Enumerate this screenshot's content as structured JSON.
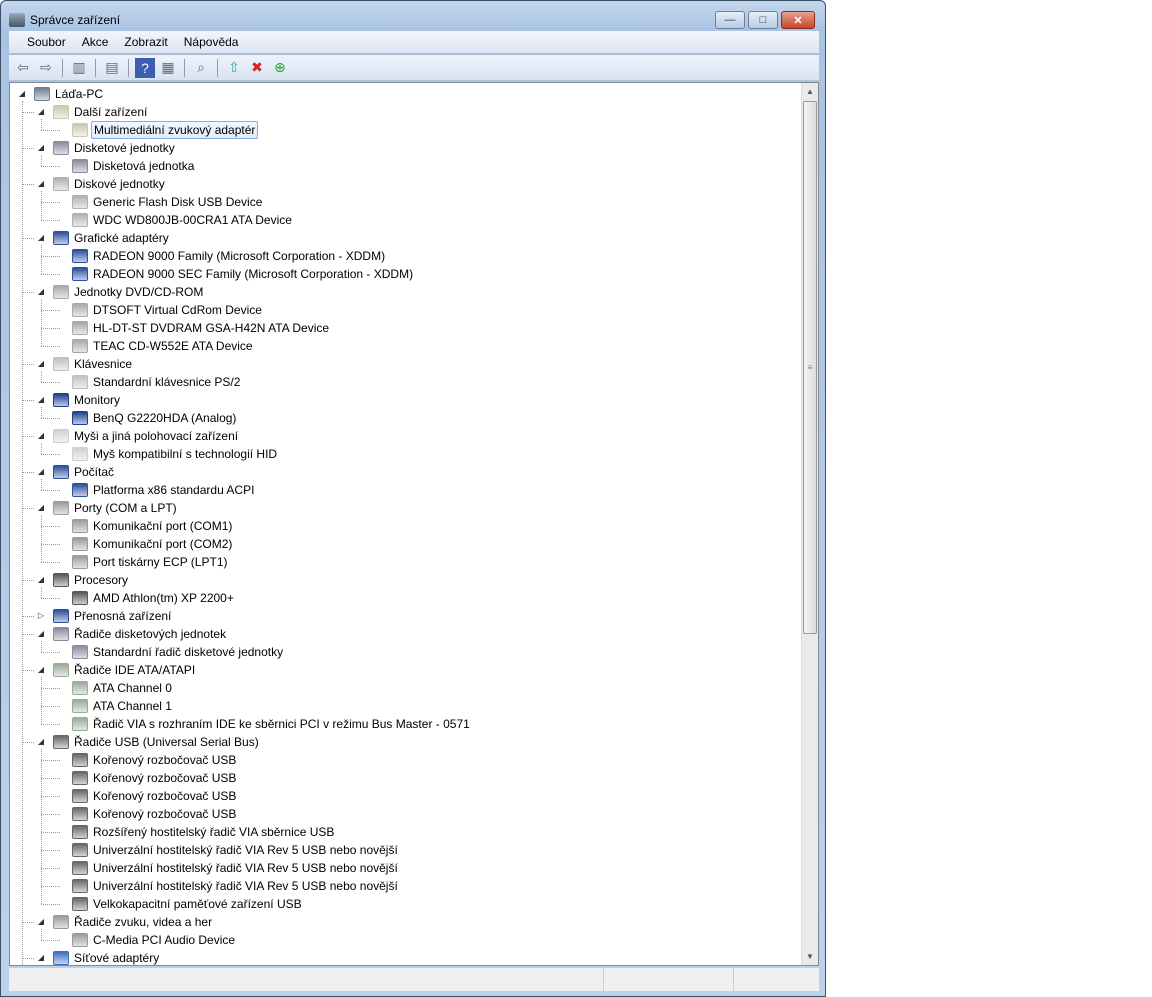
{
  "window": {
    "title": "Správce zařízení",
    "minimize": "—",
    "maximize": "□",
    "close": "✕"
  },
  "menu": [
    "Soubor",
    "Akce",
    "Zobrazit",
    "Nápověda"
  ],
  "toolbar": [
    "back-icon",
    "forward-icon",
    "|",
    "show-hide-console-tree-icon",
    "|",
    "properties-icon",
    "|",
    "help-icon",
    "show-action-pane-icon",
    "|",
    "scan-hardware-icon",
    "|",
    "update-driver-icon",
    "uninstall-icon",
    "enable-device-icon"
  ],
  "tree": [
    {
      "l": 0,
      "t": "Láďa-PC",
      "e": "open",
      "c": "#6b7f99"
    },
    {
      "l": 1,
      "t": "Další zařízení",
      "e": "open",
      "c": "#c9c9b0"
    },
    {
      "l": 2,
      "t": "Multimediální zvukový adaptér",
      "c": "#c9c9b0",
      "sel": true
    },
    {
      "l": 1,
      "t": "Disketové jednotky",
      "e": "open",
      "c": "#8a8aa0"
    },
    {
      "l": 2,
      "t": "Disketová jednotka",
      "c": "#8a8aa0"
    },
    {
      "l": 1,
      "t": "Diskové jednotky",
      "e": "open",
      "c": "#b0b0b0"
    },
    {
      "l": 2,
      "t": "Generic Flash Disk USB Device",
      "c": "#b0b0b0"
    },
    {
      "l": 2,
      "t": "WDC WD800JB-00CRA1 ATA Device",
      "c": "#b0b0b0"
    },
    {
      "l": 1,
      "t": "Grafické adaptéry",
      "e": "open",
      "c": "#2a4f9e"
    },
    {
      "l": 2,
      "t": "RADEON 9000 Family (Microsoft Corporation - XDDM)",
      "c": "#2a4f9e"
    },
    {
      "l": 2,
      "t": "RADEON 9000 SEC Family (Microsoft Corporation - XDDM)",
      "c": "#2a4f9e"
    },
    {
      "l": 1,
      "t": "Jednotky DVD/CD-ROM",
      "e": "open",
      "c": "#a8a8a8"
    },
    {
      "l": 2,
      "t": "DTSOFT Virtual CdRom Device",
      "c": "#a8a8a8"
    },
    {
      "l": 2,
      "t": "HL-DT-ST DVDRAM GSA-H42N ATA Device",
      "c": "#a8a8a8"
    },
    {
      "l": 2,
      "t": "TEAC CD-W552E ATA Device",
      "c": "#a8a8a8"
    },
    {
      "l": 1,
      "t": "Klávesnice",
      "e": "open",
      "c": "#c0c0c0"
    },
    {
      "l": 2,
      "t": "Standardní klávesnice PS/2",
      "c": "#c0c0c0"
    },
    {
      "l": 1,
      "t": "Monitory",
      "e": "open",
      "c": "#1d3f8f"
    },
    {
      "l": 2,
      "t": "BenQ G2220HDA (Analog)",
      "c": "#1d3f8f"
    },
    {
      "l": 1,
      "t": "Myši a jiná polohovací zařízení",
      "e": "open",
      "c": "#d0d0d0"
    },
    {
      "l": 2,
      "t": "Myš kompatibilní s technologií HID",
      "c": "#d0d0d0"
    },
    {
      "l": 1,
      "t": "Počítač",
      "e": "open",
      "c": "#2b4f9a"
    },
    {
      "l": 2,
      "t": "Platforma x86 standardu ACPI",
      "c": "#2b4f9a"
    },
    {
      "l": 1,
      "t": "Porty (COM a LPT)",
      "e": "open",
      "c": "#9a9a9a"
    },
    {
      "l": 2,
      "t": "Komunikační port (COM1)",
      "c": "#9a9a9a"
    },
    {
      "l": 2,
      "t": "Komunikační port (COM2)",
      "c": "#9a9a9a"
    },
    {
      "l": 2,
      "t": "Port tiskárny ECP (LPT1)",
      "c": "#9a9a9a"
    },
    {
      "l": 1,
      "t": "Procesory",
      "e": "open",
      "c": "#555"
    },
    {
      "l": 2,
      "t": "AMD Athlon(tm) XP 2200+",
      "c": "#555"
    },
    {
      "l": 1,
      "t": "Přenosná zařízení",
      "e": "closed",
      "c": "#2b4f9a"
    },
    {
      "l": 1,
      "t": "Řadiče disketových jednotek",
      "e": "open",
      "c": "#8a8aa0"
    },
    {
      "l": 2,
      "t": "Standardní řadič disketové jednotky",
      "c": "#8a8aa0"
    },
    {
      "l": 1,
      "t": "Řadiče IDE ATA/ATAPI",
      "e": "open",
      "c": "#9aaa9a"
    },
    {
      "l": 2,
      "t": "ATA Channel 0",
      "c": "#9aaa9a"
    },
    {
      "l": 2,
      "t": "ATA Channel 1",
      "c": "#9aaa9a"
    },
    {
      "l": 2,
      "t": "Řadič VIA s rozhraním IDE ke sběrnici PCI v režimu Bus Master - 0571",
      "c": "#9aaa9a"
    },
    {
      "l": 1,
      "t": "Řadiče USB (Universal Serial Bus)",
      "e": "open",
      "c": "#666"
    },
    {
      "l": 2,
      "t": "Kořenový rozbočovač USB",
      "c": "#666"
    },
    {
      "l": 2,
      "t": "Kořenový rozbočovač USB",
      "c": "#666"
    },
    {
      "l": 2,
      "t": "Kořenový rozbočovač USB",
      "c": "#666"
    },
    {
      "l": 2,
      "t": "Kořenový rozbočovač USB",
      "c": "#666"
    },
    {
      "l": 2,
      "t": "Rozšířený hostitelský řadič VIA sběrnice USB",
      "c": "#666"
    },
    {
      "l": 2,
      "t": "Univerzální hostitelský řadič VIA Rev 5 USB nebo novější",
      "c": "#666"
    },
    {
      "l": 2,
      "t": "Univerzální hostitelský řadič VIA Rev 5 USB nebo novější",
      "c": "#666"
    },
    {
      "l": 2,
      "t": "Univerzální hostitelský řadič VIA Rev 5 USB nebo novější",
      "c": "#666"
    },
    {
      "l": 2,
      "t": "Velkokapacitní paměťové zařízení USB",
      "c": "#666"
    },
    {
      "l": 1,
      "t": "Řadiče zvuku, videa a her",
      "e": "open",
      "c": "#999"
    },
    {
      "l": 2,
      "t": "C-Media PCI Audio Device",
      "c": "#999"
    },
    {
      "l": 1,
      "t": "Síťové adaptéry",
      "e": "open",
      "c": "#3a6fc0"
    }
  ]
}
